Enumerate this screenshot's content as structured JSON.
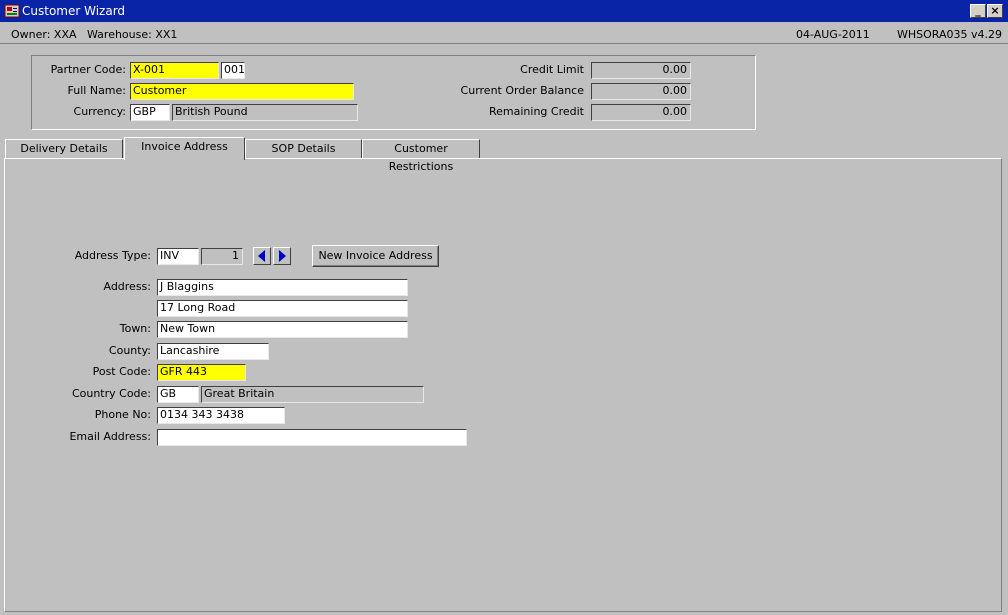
{
  "window": {
    "title": "Customer Wizard",
    "minimize_label": "_",
    "close_label": "×"
  },
  "status": {
    "owner": "Owner: XXA",
    "warehouse": "Warehouse: XX1",
    "date": "04-AUG-2011",
    "version": "WHSORA035  v4.29"
  },
  "header": {
    "partner_code_label": "Partner Code:",
    "partner_code": "X-001",
    "partner_suffix": "001",
    "full_name_label": "Full Name:",
    "full_name": "Customer",
    "currency_label": "Currency:",
    "currency_code": "GBP",
    "currency_name": "British Pound",
    "credit_limit_label": "Credit Limit",
    "credit_limit": "0.00",
    "current_order_balance_label": "Current Order Balance",
    "current_order_balance": "0.00",
    "remaining_credit_label": "Remaining Credit",
    "remaining_credit": "0.00"
  },
  "tabs": [
    {
      "label": "Delivery Details"
    },
    {
      "label": "Invoice Address"
    },
    {
      "label": "SOP Details"
    },
    {
      "label": "Customer Restrictions"
    }
  ],
  "invoice": {
    "address_type_label": "Address Type:",
    "address_type": "INV",
    "address_index": "1",
    "new_button": "New Invoice Address",
    "address_label": "Address:",
    "address_line1": "J Blaggins",
    "address_line2": "17 Long Road",
    "town_label": "Town:",
    "town": "New Town",
    "county_label": "County:",
    "county": "Lancashire",
    "post_code_label": "Post Code:",
    "post_code": "GFR 443",
    "country_code_label": "Country Code:",
    "country_code": "GB",
    "country_name": "Great Britain",
    "phone_label": "Phone No:",
    "phone": "0134 343 3438",
    "email_label": "Email Address:",
    "email": ""
  },
  "colors": {
    "titlebar": "#0a24a8",
    "required_field": "#ffff00",
    "background": "#c0c0c0"
  },
  "icons": {
    "app": "app-icon",
    "prev": "arrow-left-icon",
    "next": "arrow-right-icon"
  }
}
